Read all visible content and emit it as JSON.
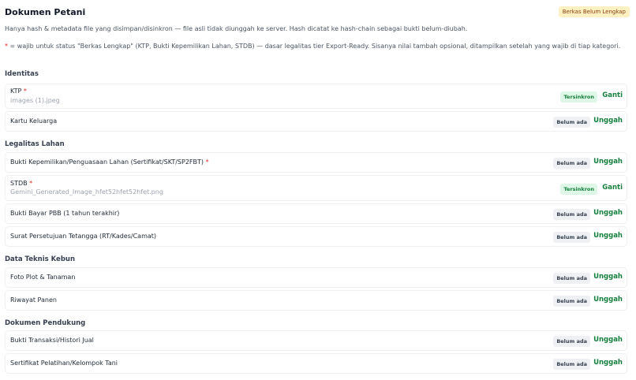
{
  "header": {
    "title": "Dokumen Petani",
    "status_badge": "Berkas Belum Lengkap"
  },
  "intro": "Hanya hash & metadata file yang disimpan/disinkron — file asli tidak diunggah ke server. Hash dicatat ke hash-chain sebagai bukti belum-diubah.",
  "note": {
    "asterisk": "*",
    "text": " = wajib untuk status \"Berkas Lengkap\" (KTP, Bukti Kepemilikan Lahan, STDB) — dasar legalitas tier Export-Ready. Sisanya nilai tambah opsional, ditampilkan setelah yang wajib di tiap kategori."
  },
  "sections": [
    {
      "title": "Identitas",
      "items": [
        {
          "label": "KTP",
          "required": "*",
          "file": "images (1).jpeg",
          "status": "Tersinkron",
          "action": "Ganti"
        },
        {
          "label": "Kartu Keluarga",
          "required": "",
          "file": "",
          "status": "Belum ada",
          "action": "Unggah"
        }
      ]
    },
    {
      "title": "Legalitas Lahan",
      "items": [
        {
          "label": "Bukti Kepemilikan/Penguasaan Lahan (Sertifikat/SKT/SP2FBT)",
          "required": "*",
          "file": "",
          "status": "Belum ada",
          "action": "Unggah"
        },
        {
          "label": "STDB",
          "required": "*",
          "file": "Gemini_Generated_Image_hfet52hfet52hfet.png",
          "status": "Tersinkron",
          "action": "Ganti"
        },
        {
          "label": "Bukti Bayar PBB (1 tahun terakhir)",
          "required": "",
          "file": "",
          "status": "Belum ada",
          "action": "Unggah"
        },
        {
          "label": "Surat Persetujuan Tetangga (RT/Kades/Camat)",
          "required": "",
          "file": "",
          "status": "Belum ada",
          "action": "Unggah"
        }
      ]
    },
    {
      "title": "Data Teknis Kebun",
      "items": [
        {
          "label": "Foto Plot & Tanaman",
          "required": "",
          "file": "",
          "status": "Belum ada",
          "action": "Unggah"
        },
        {
          "label": "Riwayat Panen",
          "required": "",
          "file": "",
          "status": "Belum ada",
          "action": "Unggah"
        }
      ]
    },
    {
      "title": "Dokumen Pendukung",
      "items": [
        {
          "label": "Bukti Transaksi/Histori Jual",
          "required": "",
          "file": "",
          "status": "Belum ada",
          "action": "Unggah"
        },
        {
          "label": "Sertifikat Pelatihan/Kelompok Tani",
          "required": "",
          "file": "",
          "status": "Belum ada",
          "action": "Unggah"
        }
      ]
    }
  ]
}
